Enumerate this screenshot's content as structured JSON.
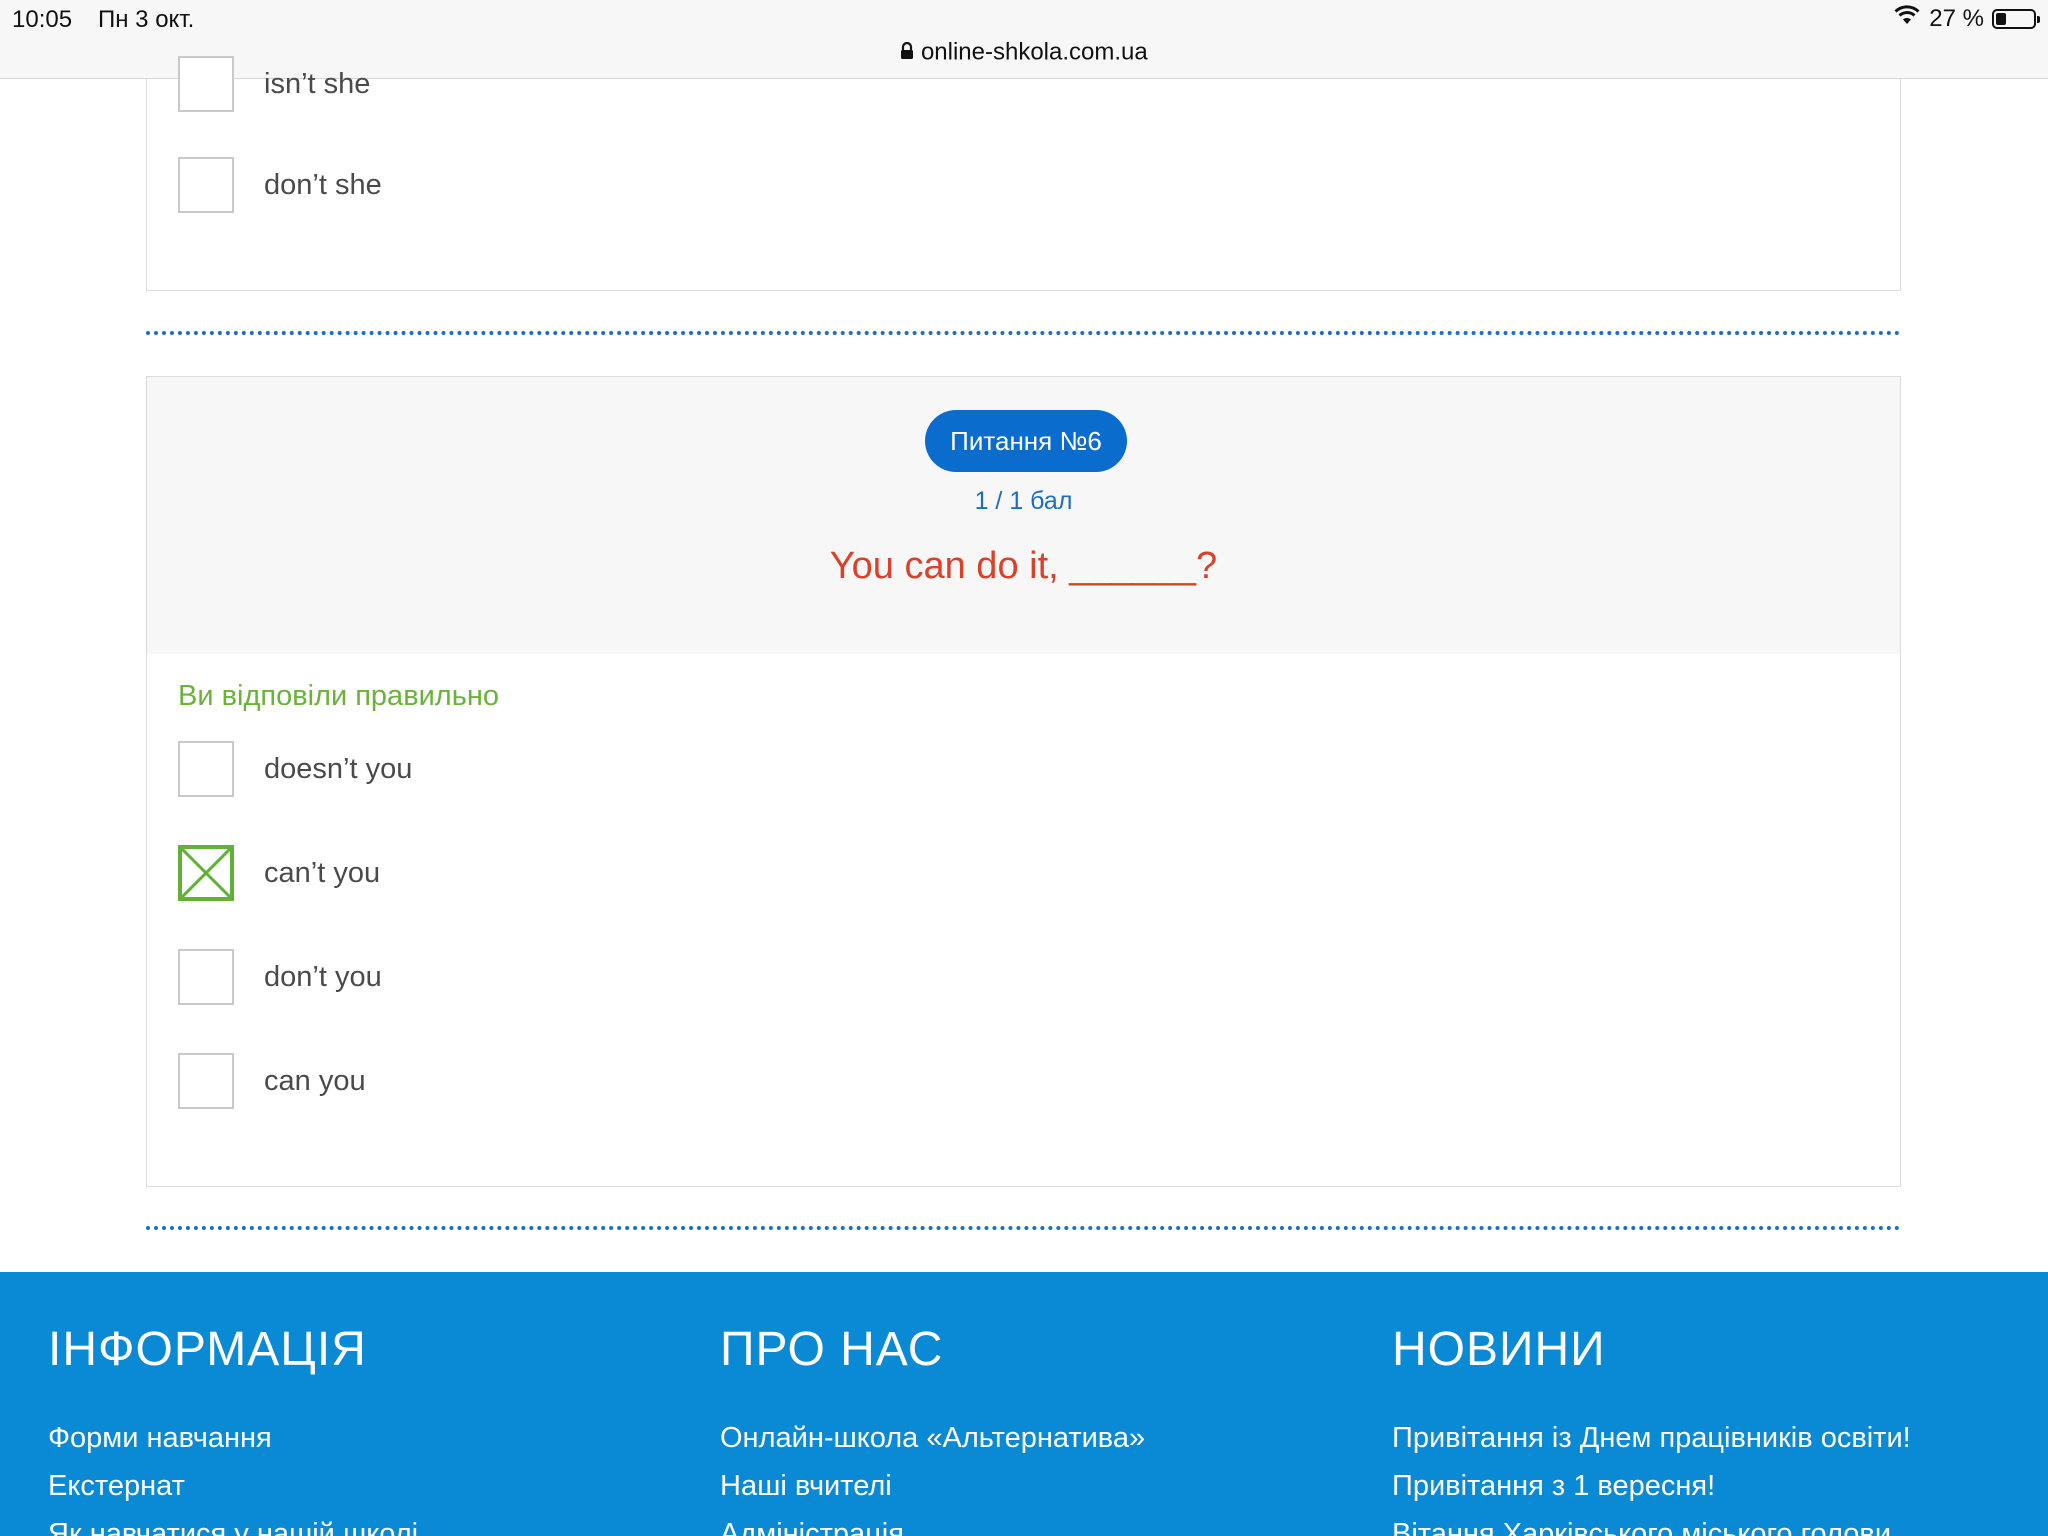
{
  "status_bar": {
    "time": "10:05",
    "date": "Пн 3 окт.",
    "battery": "27 %",
    "battery_level": 0.27,
    "url": "online-shkola.com.ua"
  },
  "prev_question": {
    "options": [
      {
        "label": "isn’t she",
        "checked": false
      },
      {
        "label": "don’t she",
        "checked": false
      }
    ]
  },
  "question": {
    "badge": "Питання №6",
    "score": "1 / 1 бал",
    "text": "You can do it, ______?",
    "result": "Ви відповіли правильно",
    "options": [
      {
        "label": "doesn’t you",
        "checked": false
      },
      {
        "label": "can’t you",
        "checked": true
      },
      {
        "label": "don’t you",
        "checked": false
      },
      {
        "label": "can you",
        "checked": false
      }
    ]
  },
  "footer": {
    "columns": [
      {
        "title": "ІНФОРМАЦІЯ",
        "links": [
          "Форми навчання",
          "Екстернат",
          "Як навчатися у нашій школі"
        ]
      },
      {
        "title": "ПРО НАС",
        "links": [
          "Онлайн-школа «Альтернатива»",
          "Наші вчителі",
          "Адміністрація"
        ]
      },
      {
        "title": "НОВИНИ",
        "links": [
          "Привітання із Днем працівників освіти!",
          "Привітання з 1 вересня!",
          "Вітання Харківського міського голови"
        ]
      }
    ]
  },
  "colors": {
    "accent_blue": "#0a6ccd",
    "footer_blue": "#0a8ad4",
    "question_red": "#d9412b",
    "correct_green": "#6bb23a"
  }
}
